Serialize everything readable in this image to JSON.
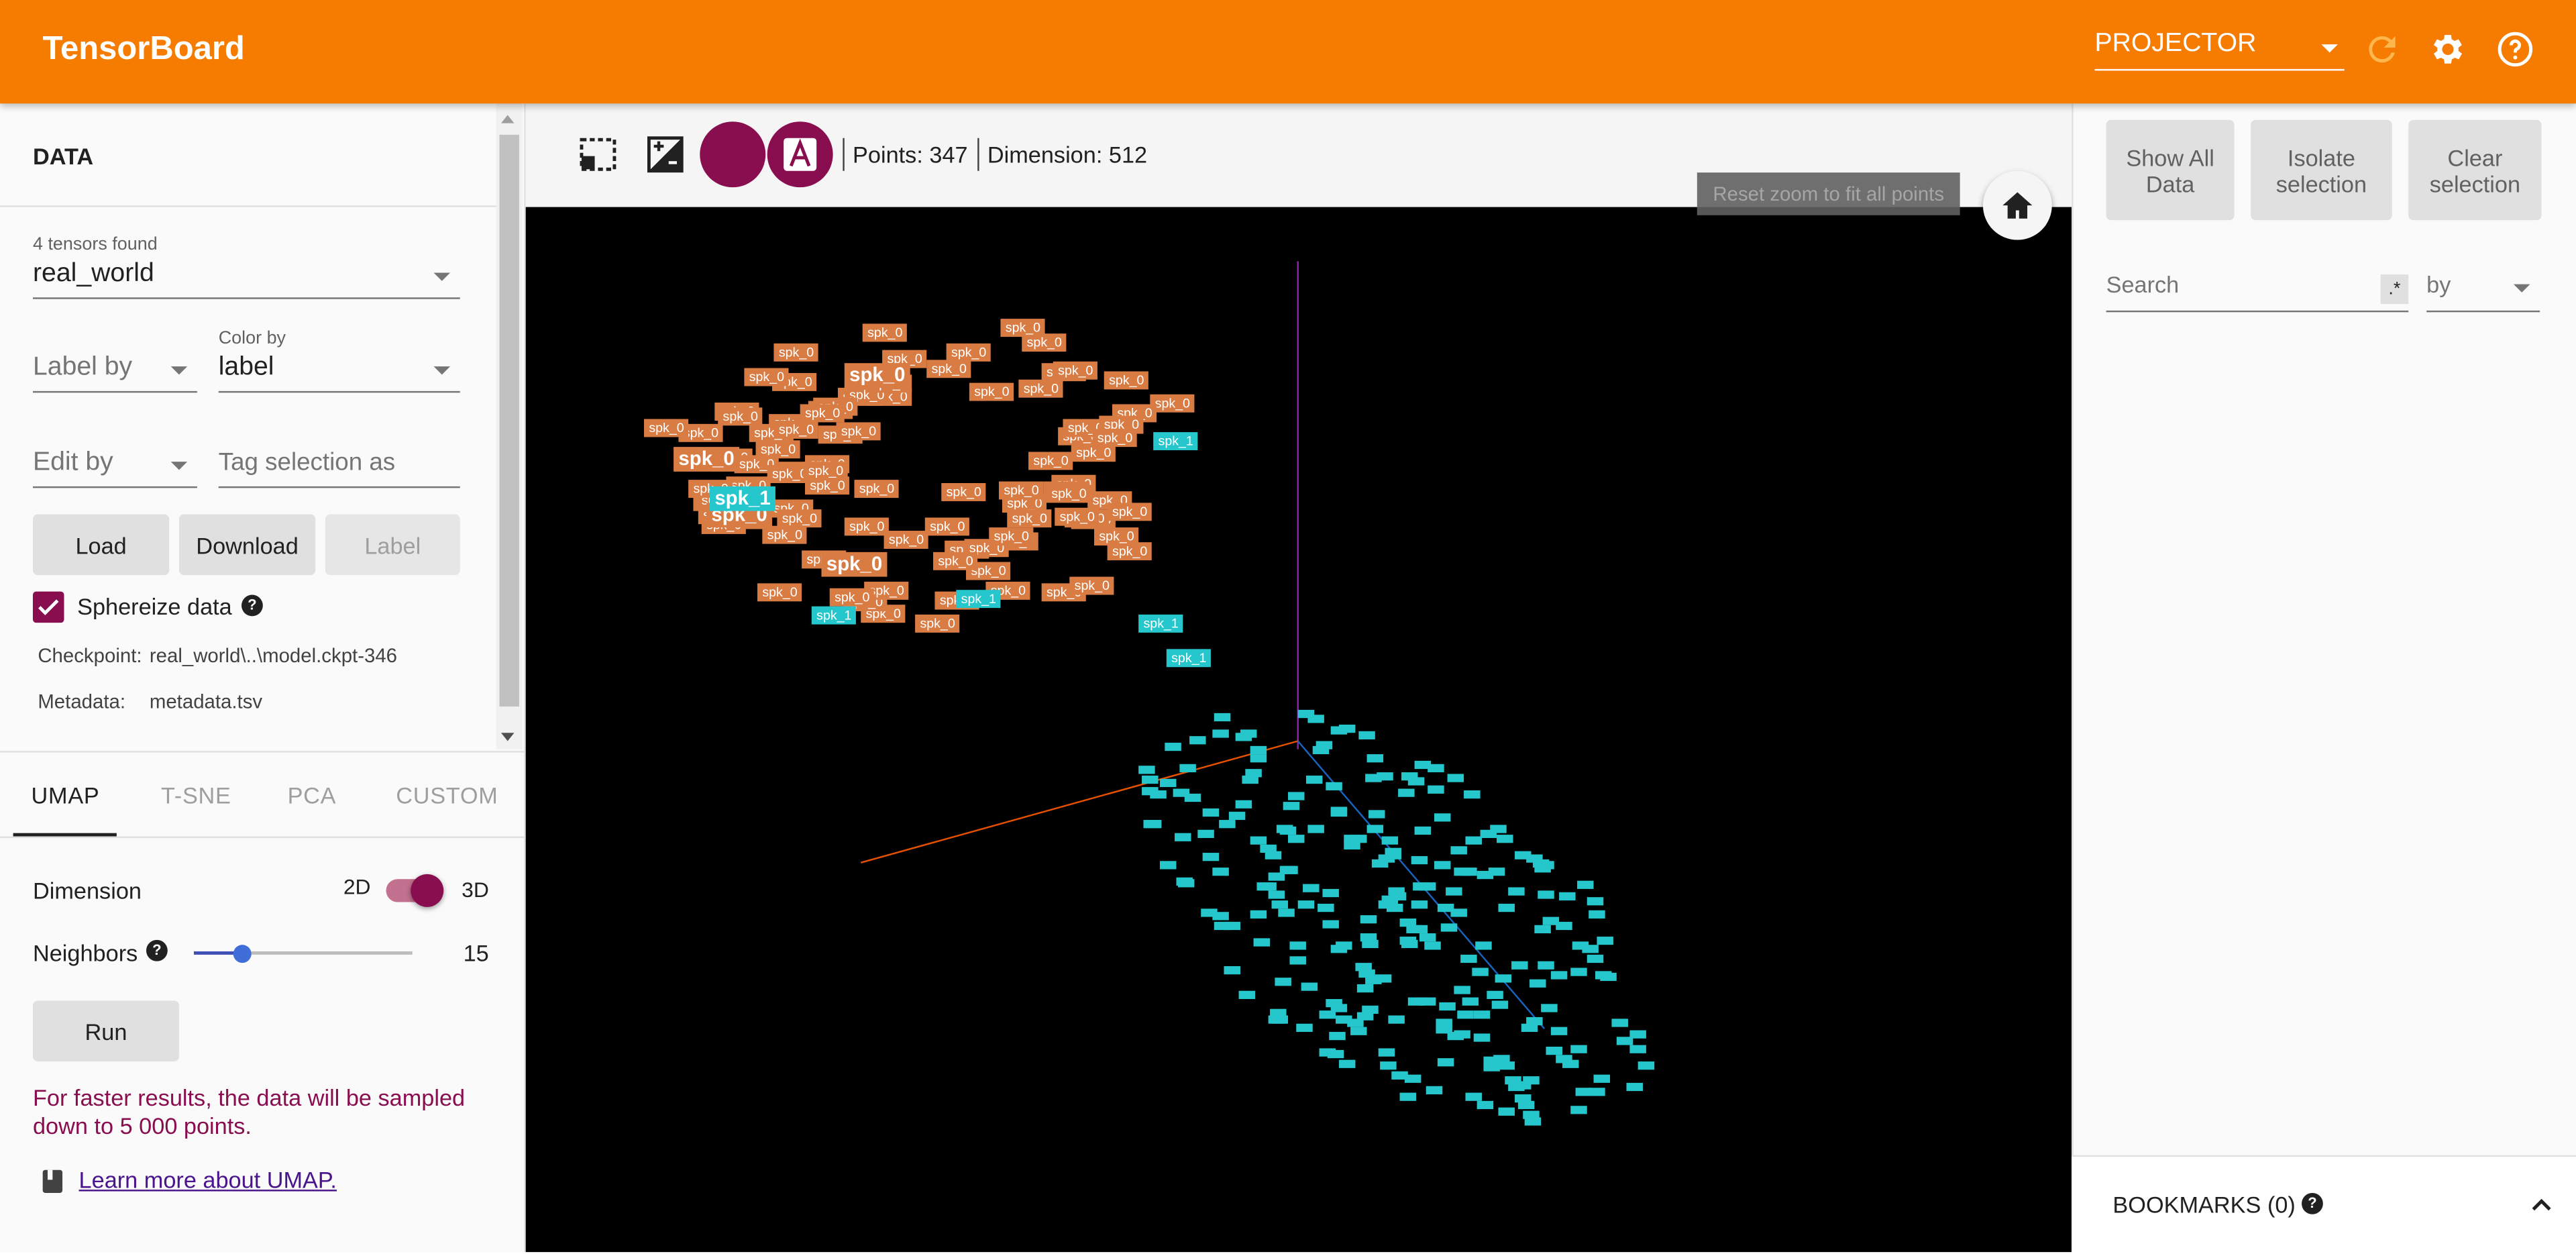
{
  "header": {
    "brand": "TensorBoard",
    "dashboard_select": "PROJECTOR"
  },
  "left": {
    "title": "DATA",
    "tensors_found": "4 tensors found",
    "tensor_select": "real_world",
    "label_by_placeholder": "Label by",
    "color_by_label": "Color by",
    "color_by_value": "label",
    "edit_by_placeholder": "Edit by",
    "tag_selection_placeholder": "Tag selection as",
    "buttons": {
      "load": "Load",
      "download": "Download",
      "label": "Label"
    },
    "sphereize": {
      "label": "Sphereize data",
      "checked": true
    },
    "checkpoint_label": "Checkpoint:",
    "checkpoint_value": "real_world\\..\\model.ckpt-346",
    "metadata_label": "Metadata:",
    "metadata_value": "metadata.tsv",
    "tabs": [
      "UMAP",
      "T-SNE",
      "PCA",
      "CUSTOM"
    ],
    "active_tab": "UMAP",
    "dimension_label": "Dimension",
    "dim_2d": "2D",
    "dim_3d": "3D",
    "neighbors_label": "Neighbors",
    "neighbors_value": "15",
    "neighbors_fraction": 0.22,
    "run_button": "Run",
    "hint": "For faster results, the data will be sampled down to 5 000 points.",
    "learn_more": "Learn more about UMAP."
  },
  "toolbar": {
    "points": "Points: 347",
    "dimension": "Dimension: 512",
    "tooltip": "Reset zoom to fit all points"
  },
  "right": {
    "buttons": {
      "show_all": "Show All Data",
      "isolate": "Isolate selection",
      "clear": "Clear selection"
    },
    "search_placeholder": "Search",
    "regex_label": ".*",
    "by_placeholder": "by",
    "bookmarks": "BOOKMARKS (0)"
  },
  "points": {
    "orange_label": "spk_0",
    "cyan_label": "spk_1",
    "colors": {
      "orange": "#d97c44",
      "cyan": "#25c6cc"
    }
  },
  "colors": {
    "accent": "#f57c00",
    "primary": "#880e4f",
    "canvas": "#000000"
  }
}
